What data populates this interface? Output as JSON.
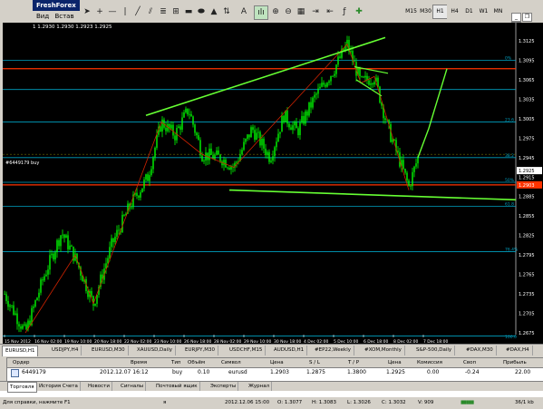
{
  "window": {
    "title": "FreshForex"
  },
  "menu": [
    "Вид",
    "Встав"
  ],
  "timeframes": [
    {
      "label": "M15",
      "active": false
    },
    {
      "label": "M30",
      "active": false
    },
    {
      "label": "H1",
      "active": true
    },
    {
      "label": "H4",
      "active": false
    },
    {
      "label": "D1",
      "active": false
    },
    {
      "label": "W1",
      "active": false
    },
    {
      "label": "MN",
      "active": false
    }
  ],
  "chart": {
    "ohlc_text": "1 1.2930 1.2930 1.2923 1.2925",
    "order_label": "#6449179 buy",
    "price_axis": [
      "1.3125",
      "1.3095",
      "1.3065",
      "1.3035",
      "1.3005",
      "1.2975",
      "1.2945",
      "1.2915",
      "1.2885",
      "1.2855",
      "1.2825",
      "1.2795",
      "1.2765",
      "1.2735",
      "1.2705",
      "1.2675"
    ],
    "current_price": "1.2925",
    "order_price": "1.2903",
    "fib_labels": [
      "0%",
      "23.6",
      "38.2",
      "50%",
      "61.8",
      "76.4%",
      "100.0"
    ],
    "time_axis": [
      "15 Nov 2012",
      "16 Nov 02:00",
      "19 Nov 10:00",
      "20 Nov 18:00",
      "22 Nov 02:00",
      "23 Nov 10:00",
      "26 Nov 18:00",
      "28 Nov 02:00",
      "29 Nov 10:00",
      "30 Nov 18:00",
      "4 Dec 02:00",
      "5 Dec 10:00",
      "6 Dec 18:00",
      "8 Dec 02:00",
      "7 Dec 18:00"
    ],
    "colors": {
      "background": "#000000",
      "candles": "#00ff00",
      "trend": "#66ff33",
      "level_red": "#ff3300",
      "fib": "#00a0c0"
    }
  },
  "chart_tabs": [
    {
      "label": "EURUSD,H1",
      "active": true
    },
    {
      "label": "USDJPY,H4",
      "active": false
    },
    {
      "label": "EURUSD,M30",
      "active": false
    },
    {
      "label": "XAUUSD,Daily",
      "active": false
    },
    {
      "label": "EURJPY,M30",
      "active": false
    },
    {
      "label": "USDCHF,M15",
      "active": false
    },
    {
      "label": "AUDUSD,H1",
      "active": false
    },
    {
      "label": "#EP22,Weekly",
      "active": false
    },
    {
      "label": "#XOM,Monthly",
      "active": false
    },
    {
      "label": "S&P-500,Daily",
      "active": false
    },
    {
      "label": "#DAX,M30",
      "active": false
    },
    {
      "label": "#DAX,H4",
      "active": false
    }
  ],
  "terminal": {
    "columns": [
      "Ордер",
      "Время",
      "Тип",
      "Объём",
      "Символ",
      "Цена",
      "S / L",
      "T / P",
      "Цена",
      "Комиссия",
      "Своп",
      "Прибыль"
    ],
    "row": [
      "6449179",
      "2012.12.07 16:12",
      "buy",
      "0.10",
      "eurusd",
      "1.2903",
      "1.2875",
      "1.3800",
      "1.2925",
      "0.00",
      "-0.24",
      "22.00"
    ],
    "tabs": [
      {
        "label": "Торговля",
        "active": true
      },
      {
        "label": "История Счета",
        "active": false
      },
      {
        "label": "Новости",
        "active": false
      },
      {
        "label": "Сигналы",
        "active": false
      },
      {
        "label": "Почтовый ящик",
        "active": false
      },
      {
        "label": "Эксперты",
        "active": false
      },
      {
        "label": "Журнал",
        "active": false
      }
    ]
  },
  "status": {
    "help": "Для справки, нажмите F1",
    "profile": "я",
    "time": "2012.12.06 15:00",
    "open": "O: 1.3077",
    "high": "H: 1.3083",
    "low": "L: 1.3026",
    "close": "C: 1.3032",
    "volume": "V: 909",
    "traffic": "36/1 kb"
  }
}
